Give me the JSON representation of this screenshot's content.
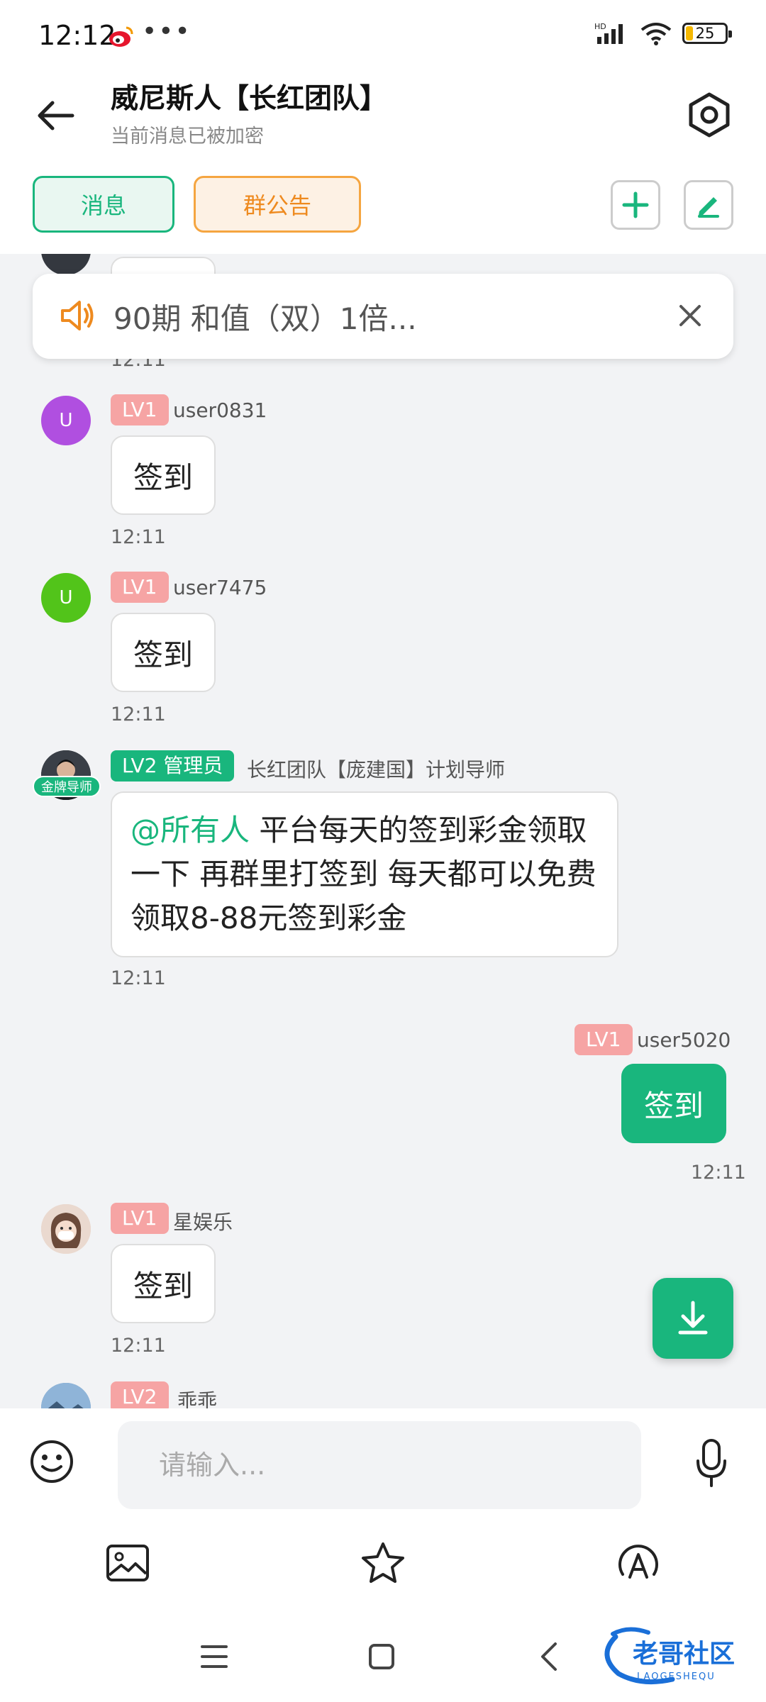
{
  "status_bar": {
    "time": "12:12",
    "dots": "•••",
    "signal_tag": "HD",
    "battery": "25"
  },
  "header": {
    "title": "威尼斯人【长红团队】",
    "subtitle": "当前消息已被加密"
  },
  "tabs": [
    {
      "label": "消息"
    },
    {
      "label": "群公告"
    }
  ],
  "notice": {
    "text": "90期 和值（双）1倍..."
  },
  "messages": [
    {
      "avatar_text": "U",
      "avatar_color": "#b04fe0",
      "level": "LV1",
      "user": "user0831",
      "text": "签到",
      "time": "12:11"
    },
    {
      "avatar_text": "U",
      "avatar_color": "#52c41a",
      "level": "LV1",
      "user": "user7475",
      "text": "签到",
      "time": "12:11"
    },
    {
      "badge": "金牌导师",
      "level": "LV2 管理员",
      "user": "长红团队【庞建国】计划导师",
      "mention": "@所有人",
      "text": " 平台每天的签到彩金领取一下 再群里打签到  每天都可以免费领取8-88元签到彩金",
      "time": "12:11"
    },
    {
      "level": "LV1",
      "user": "user5020",
      "text": "签到",
      "time": "12:11",
      "mine": true
    },
    {
      "level": "LV1",
      "user": "星娱乐",
      "text": "签到",
      "time": "12:11"
    },
    {
      "level": "LV2",
      "user": "乖乖"
    }
  ],
  "partial_time": "12:11",
  "input": {
    "placeholder": "请输入..."
  },
  "watermark": {
    "text": "老哥社区",
    "sub": "LAOGESHEQU"
  },
  "colors": {
    "accent": "#19b67d",
    "notice_orange": "#ee8a1f",
    "level_pink": "#f6a4a4"
  }
}
